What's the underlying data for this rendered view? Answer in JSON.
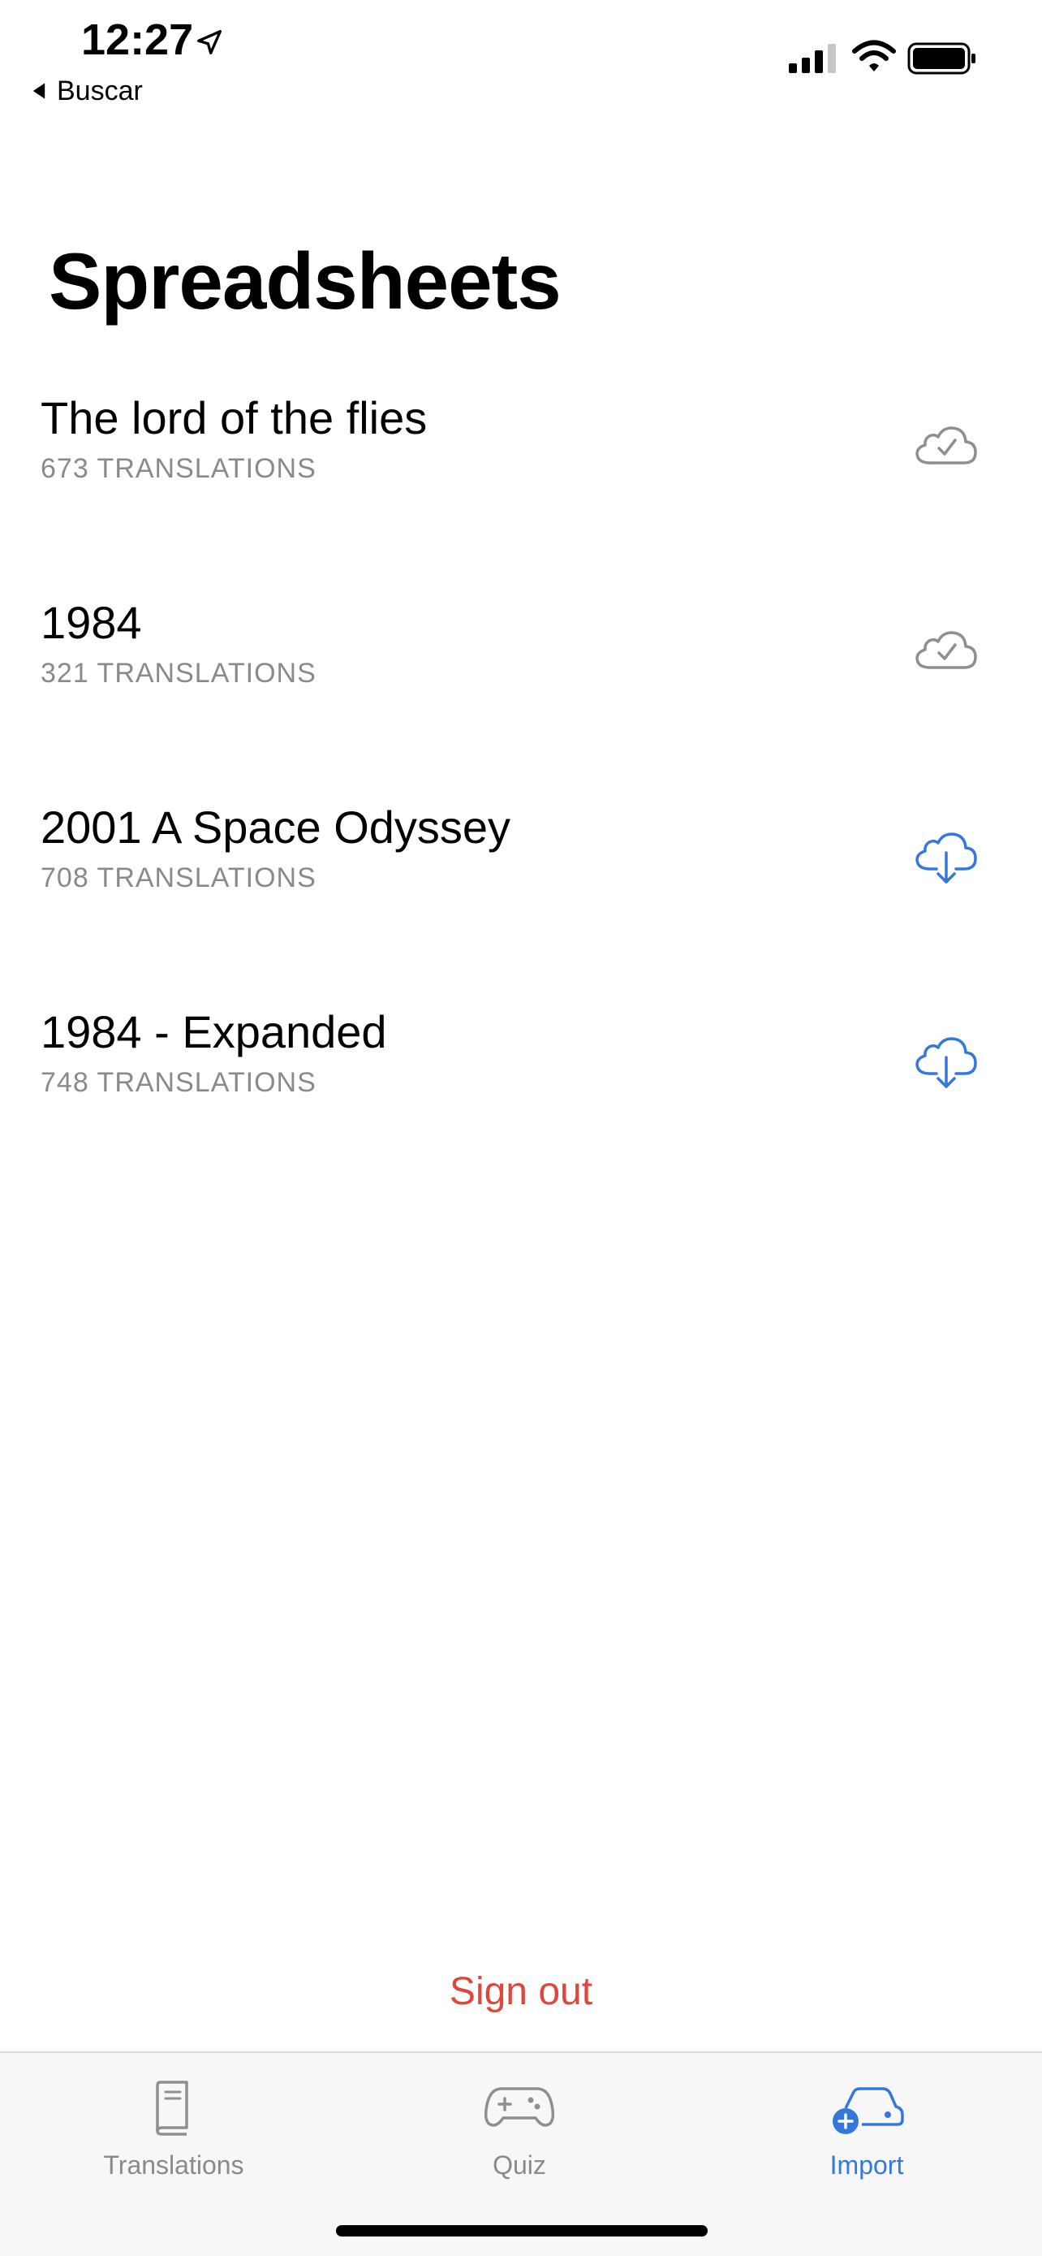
{
  "status_bar": {
    "time": "12:27",
    "back_label": "Buscar"
  },
  "title": "Spreadsheets",
  "spreadsheets": [
    {
      "name": "The lord of the flies",
      "count": "673 TRANSLATIONS",
      "status": "downloaded"
    },
    {
      "name": "1984",
      "count": "321 TRANSLATIONS",
      "status": "downloaded"
    },
    {
      "name": "2001 A Space Odyssey",
      "count": "708 TRANSLATIONS",
      "status": "download"
    },
    {
      "name": "1984 - Expanded",
      "count": "748 TRANSLATIONS",
      "status": "download"
    }
  ],
  "sign_out_label": "Sign out",
  "tabs": [
    {
      "label": "Translations",
      "icon": "book-icon",
      "active": false
    },
    {
      "label": "Quiz",
      "icon": "gamepad-icon",
      "active": false
    },
    {
      "label": "Import",
      "icon": "car-plus-icon",
      "active": true
    }
  ],
  "colors": {
    "accent": "#3478db",
    "destructive": "#e0463a",
    "secondary_text": "#8a8a8e",
    "downloaded_icon": "#8e8e93"
  }
}
